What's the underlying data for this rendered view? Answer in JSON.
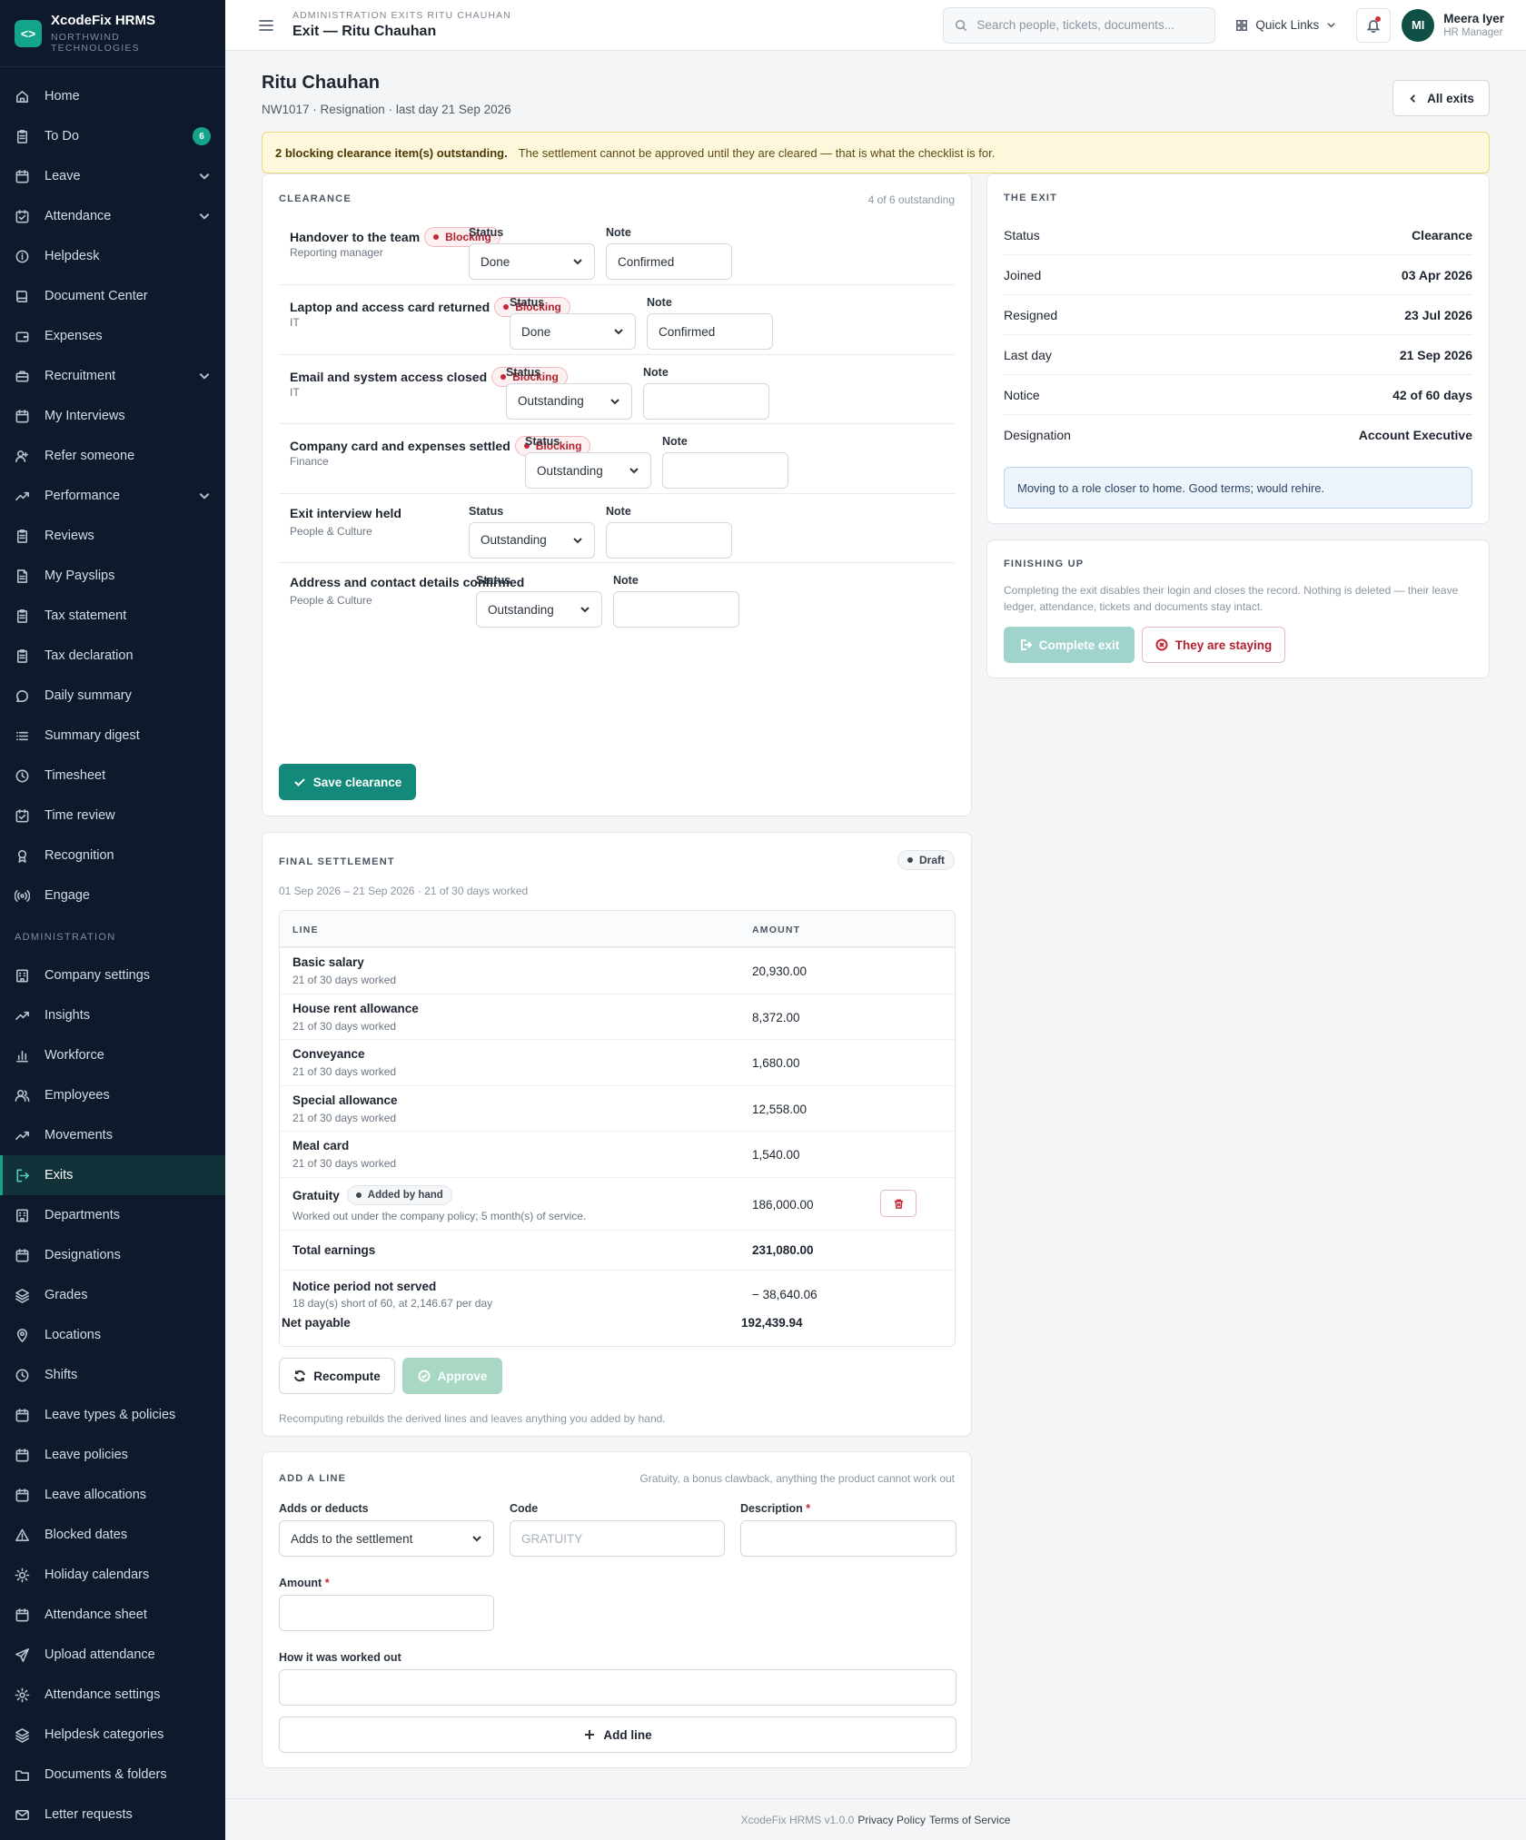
{
  "brand": {
    "name": "XcodeFix HRMS",
    "subtitle": "NORTHWIND TECHNOLOGIES",
    "logo": "code-brackets-icon"
  },
  "nav": {
    "items": [
      {
        "label": "Home",
        "icon": "home-icon"
      },
      {
        "label": "To Do",
        "icon": "clipboard-icon",
        "badge": "6"
      },
      {
        "label": "Leave",
        "icon": "calendar-icon",
        "expand": true
      },
      {
        "label": "Attendance",
        "icon": "calendar-check-icon",
        "expand": true
      },
      {
        "label": "Helpdesk",
        "icon": "info-icon"
      },
      {
        "label": "Document Center",
        "icon": "book-icon"
      },
      {
        "label": "Expenses",
        "icon": "wallet-icon"
      },
      {
        "label": "Recruitment",
        "icon": "briefcase-icon",
        "expand": true
      },
      {
        "label": "My Interviews",
        "icon": "calendar-icon"
      },
      {
        "label": "Refer someone",
        "icon": "user-plus-icon"
      },
      {
        "label": "Performance",
        "icon": "trending-icon",
        "expand": true
      },
      {
        "label": "Reviews",
        "icon": "clipboard-icon"
      },
      {
        "label": "My Payslips",
        "icon": "file-icon"
      },
      {
        "label": "Tax statement",
        "icon": "clipboard-icon"
      },
      {
        "label": "Tax declaration",
        "icon": "clipboard-icon"
      },
      {
        "label": "Daily summary",
        "icon": "chat-icon"
      },
      {
        "label": "Summary digest",
        "icon": "list-icon"
      },
      {
        "label": "Timesheet",
        "icon": "clock-icon"
      },
      {
        "label": "Time review",
        "icon": "calendar-check-icon"
      },
      {
        "label": "Recognition",
        "icon": "award-icon"
      },
      {
        "label": "Engage",
        "icon": "broadcast-icon"
      }
    ],
    "section": "ADMINISTRATION",
    "admin_items": [
      {
        "label": "Company settings",
        "icon": "building-icon"
      },
      {
        "label": "Insights",
        "icon": "trending-icon"
      },
      {
        "label": "Workforce",
        "icon": "bar-chart-icon"
      },
      {
        "label": "Employees",
        "icon": "users-icon"
      },
      {
        "label": "Movements",
        "icon": "trending-icon"
      },
      {
        "label": "Exits",
        "icon": "log-out-icon",
        "active": true
      },
      {
        "label": "Departments",
        "icon": "building-icon"
      },
      {
        "label": "Designations",
        "icon": "calendar-icon"
      },
      {
        "label": "Grades",
        "icon": "layers-icon"
      },
      {
        "label": "Locations",
        "icon": "map-pin-icon"
      },
      {
        "label": "Shifts",
        "icon": "clock-icon"
      },
      {
        "label": "Leave types & policies",
        "icon": "calendar-icon"
      },
      {
        "label": "Leave policies",
        "icon": "calendar-icon"
      },
      {
        "label": "Leave allocations",
        "icon": "calendar-icon"
      },
      {
        "label": "Blocked dates",
        "icon": "alert-triangle-icon"
      },
      {
        "label": "Holiday calendars",
        "icon": "sun-icon"
      },
      {
        "label": "Attendance sheet",
        "icon": "calendar-icon"
      },
      {
        "label": "Upload attendance",
        "icon": "send-icon"
      },
      {
        "label": "Attendance settings",
        "icon": "settings-icon"
      },
      {
        "label": "Helpdesk categories",
        "icon": "layers-icon"
      },
      {
        "label": "Documents & folders",
        "icon": "folder-icon"
      },
      {
        "label": "Letter requests",
        "icon": "mail-icon"
      }
    ]
  },
  "topbar": {
    "breadcrumb": "ADMINISTRATION EXITS RITU CHAUHAN",
    "title": "Exit — Ritu Chauhan",
    "search_placeholder": "Search people, tickets, documents...",
    "quick_links": "Quick Links",
    "user_name": "Meera Iyer",
    "user_role": "HR Manager",
    "user_initials": "MI"
  },
  "header": {
    "name": "Ritu Chauhan",
    "meta": "NW1017 · Resignation · last day 21 Sep 2026",
    "all_exits": "All exits"
  },
  "alert": {
    "strong": "2 blocking clearance item(s) outstanding.",
    "text": "The settlement cannot be approved until they are cleared — that is what the checklist is for."
  },
  "clearance": {
    "title": "CLEARANCE",
    "outstanding": "4 of 6 outstanding",
    "status_label": "Status",
    "note_label": "Note",
    "blocking_label": "Blocking",
    "items": [
      {
        "name": "Handover to the team",
        "owner": "Reporting manager",
        "blocking": true,
        "status": "Done",
        "note": "Confirmed"
      },
      {
        "name": "Laptop and access card returned",
        "owner": "IT",
        "blocking": true,
        "status": "Done",
        "note": "Confirmed"
      },
      {
        "name": "Email and system access closed",
        "owner": "IT",
        "blocking": true,
        "status": "Outstanding",
        "note": ""
      },
      {
        "name": "Company card and expenses settled",
        "owner": "Finance",
        "blocking": true,
        "status": "Outstanding",
        "note": ""
      },
      {
        "name": "Exit interview held",
        "owner": "People & Culture",
        "blocking": false,
        "status": "Outstanding",
        "note": ""
      },
      {
        "name": "Address and contact details confirmed",
        "owner": "People & Culture",
        "blocking": false,
        "status": "Outstanding",
        "note": ""
      }
    ],
    "save_label": "Save clearance"
  },
  "exit_info": {
    "title": "THE EXIT",
    "rows": [
      {
        "label": "Status",
        "value": "Clearance"
      },
      {
        "label": "Joined",
        "value": "03 Apr 2026"
      },
      {
        "label": "Resigned",
        "value": "23 Jul 2026"
      },
      {
        "label": "Last day",
        "value": "21 Sep 2026"
      },
      {
        "label": "Notice",
        "value": "42 of 60 days"
      },
      {
        "label": "Designation",
        "value": "Account Executive"
      }
    ],
    "note": "Moving to a role closer to home. Good terms; would rehire."
  },
  "finishing": {
    "title": "FINISHING UP",
    "text": "Completing the exit disables their login and closes the record. Nothing is deleted — their leave ledger, attendance, tickets and documents stay intact.",
    "complete_label": "Complete exit",
    "staying_label": "They are staying"
  },
  "settlement": {
    "title": "FINAL SETTLEMENT",
    "status": "Draft",
    "period": "01 Sep 2026 – 21 Sep 2026 · 21 of 30 days worked",
    "col_line": "LINE",
    "col_amount": "AMOUNT",
    "lines": [
      {
        "name": "Basic salary",
        "sub": "21 of 30 days worked",
        "amount": "20,930.00"
      },
      {
        "name": "House rent allowance",
        "sub": "21 of 30 days worked",
        "amount": "8,372.00"
      },
      {
        "name": "Conveyance",
        "sub": "21 of 30 days worked",
        "amount": "1,680.00"
      },
      {
        "name": "Special allowance",
        "sub": "21 of 30 days worked",
        "amount": "12,558.00"
      },
      {
        "name": "Meal card",
        "sub": "21 of 30 days worked",
        "amount": "1,540.00"
      }
    ],
    "gratuity": {
      "name": "Gratuity",
      "tag": "Added by hand",
      "sub": "Worked out under the company policy; 5 month(s) of service.",
      "amount": "186,000.00"
    },
    "total_label": "Total earnings",
    "total_amount": "231,080.00",
    "notice": {
      "name": "Notice period not served",
      "sub": "18 day(s) short of 60, at 2,146.67 per day",
      "amount": "− 38,640.06"
    },
    "net_label": "Net payable",
    "net_amount": "192,439.94",
    "recompute_label": "Recompute",
    "approve_label": "Approve",
    "hint": "Recomputing rebuilds the derived lines and leaves anything you added by hand."
  },
  "add_line": {
    "title": "ADD A LINE",
    "hint": "Gratuity, a bonus clawback, anything the product cannot work out",
    "type_label": "Adds or deducts",
    "type_value": "Adds to the settlement",
    "code_label": "Code",
    "code_placeholder": "GRATUITY",
    "desc_label": "Description",
    "amount_label": "Amount",
    "worked_label": "How it was worked out",
    "add_label": "Add line",
    "required": "*"
  },
  "footer": {
    "version": "XcodeFix HRMS v1.0.0",
    "privacy": "Privacy Policy",
    "terms": "Terms of Service"
  },
  "colors": {
    "accent": "#14a38b",
    "sidebar": "#0e1a2b",
    "danger": "#c62636",
    "warning_bg": "#fdf8dc"
  }
}
